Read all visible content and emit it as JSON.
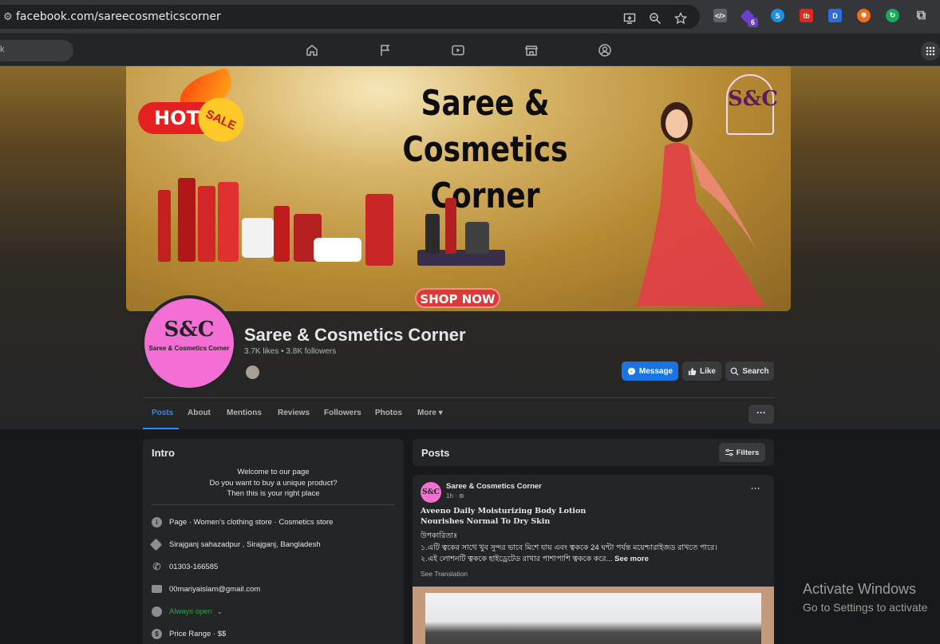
{
  "browser": {
    "url": "facebook.com/sareecosmeticscorner",
    "tools": [
      "install-icon",
      "zoom-icon",
      "star-icon"
    ],
    "extensions": [
      {
        "name": "code-ext-icon",
        "color": "#5f6368",
        "glyph": "</>"
      },
      {
        "name": "puzzle-ext-icon",
        "color": "#6a3fc9",
        "glyph": "◆"
      },
      {
        "name": "sync-ext-icon",
        "color": "#1a8fe3",
        "glyph": "S"
      },
      {
        "name": "tb-ext-icon",
        "color": "#e0291c",
        "glyph": "tb"
      },
      {
        "name": "translate-ext-icon",
        "color": "#2a6de0",
        "glyph": "D"
      },
      {
        "name": "fire-ext-icon",
        "color": "#ef6a1a",
        "glyph": "✹"
      },
      {
        "name": "refresh-ext-icon",
        "color": "#1aa95c",
        "glyph": "↻"
      },
      {
        "name": "extensions-icon",
        "color": "#35363a",
        "glyph": "⧉"
      }
    ],
    "badge": "6"
  },
  "fbnav": {
    "search_fragment": "k"
  },
  "cover": {
    "title_line1": "Saree & Cosmetics",
    "title_line2": "Corner",
    "hot": "HOT",
    "sale": "SALE",
    "shop_now": "SHOP NOW",
    "logo": "S&C"
  },
  "profile": {
    "avatar_mark": "S&C",
    "avatar_name": "Saree & Cosmetics Corner",
    "name": "Saree & Cosmetics Corner",
    "stats": "3.7K likes • 3.8K followers"
  },
  "actions": {
    "message": "Message",
    "like": "Like",
    "search": "Search"
  },
  "tabs": [
    {
      "label": "Posts"
    },
    {
      "label": "About"
    },
    {
      "label": "Mentions"
    },
    {
      "label": "Reviews"
    },
    {
      "label": "Followers"
    },
    {
      "label": "Photos"
    },
    {
      "label": "More ▾"
    }
  ],
  "intro": {
    "title": "Intro",
    "bio": [
      "Welcome to our page",
      "Do you want to buy a unique product?",
      "Then this is your right place"
    ],
    "rows": [
      {
        "icon": "info-icon",
        "text": "Page · Women's clothing store · Cosmetics store"
      },
      {
        "icon": "location-icon",
        "text": "Sirajganj sahazadpur , Sirajganj, Bangladesh"
      },
      {
        "icon": "phone-icon",
        "text": "01303-166585"
      },
      {
        "icon": "email-icon",
        "text": "00mariyaislam@gmail.com"
      },
      {
        "icon": "clock-icon",
        "text": "Always open"
      },
      {
        "icon": "price-icon",
        "text": "Price Range · $$"
      }
    ]
  },
  "posts": {
    "title": "Posts",
    "filters": "Filters",
    "post": {
      "author": "Saree & Cosmetics Corner",
      "avatar_mark": "S&C",
      "time": "1h · ⊚",
      "heading1": "Aveeno Daily Moisturizing Body Lotion",
      "heading2": "Nourishes Normal To Dry Skin",
      "line1": "উপকারিতাঃ",
      "line2": "১.এটি ত্বকের সাথে খুব সুন্দর ভাবে মিশে যায় এবং ত্বককে 24 ঘন্টা পর্যন্ত ময়েশ্চারাইজড রাখতে পারে।",
      "line3": "২.এই লোশনটি ত্বককে হাইড্রেটেড রাখার পাশাপাশি ত্বককে করে...",
      "see_more": "See more",
      "see_translation": "See Translation"
    }
  },
  "watermark": {
    "line1": "Activate Windows",
    "line2": "Go to Settings to activate"
  }
}
